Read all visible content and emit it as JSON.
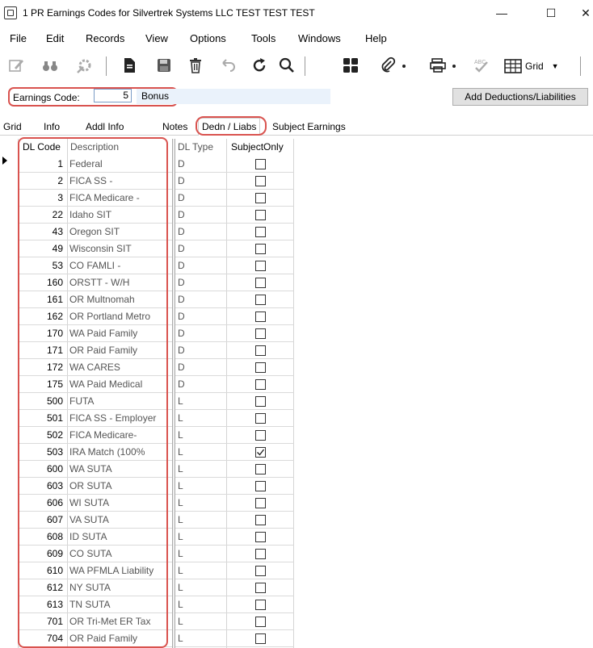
{
  "window": {
    "title": "1 PR Earnings Codes for Silvertrek Systems LLC TEST TEST TEST",
    "minimize": "—",
    "maximize": "☐",
    "close": "✕"
  },
  "menu": [
    "File",
    "Edit",
    "Records",
    "View",
    "Options",
    "Tools",
    "Windows",
    "Help"
  ],
  "toolbar": {
    "grid_label": "Grid",
    "icons": [
      "edit-icon",
      "binoculars-icon",
      "settings-wand-icon",
      "document-icon",
      "save-icon",
      "delete-icon",
      "undo-icon",
      "refresh-icon",
      "search-icon",
      "calculator-icon",
      "attach-icon",
      "print-icon",
      "spellcheck-icon",
      "grid-view-icon"
    ]
  },
  "form": {
    "earnings_code_label": "Earnings Code:",
    "earnings_code_value": "5",
    "earnings_code_desc": "Bonus",
    "add_button": "Add Deductions/Liabilities"
  },
  "tabs": [
    "Grid",
    "Info",
    "Addl Info",
    "Notes",
    "Dedn / Liabs",
    "Subject Earnings"
  ],
  "selected_tab": "Dedn / Liabs",
  "grid": {
    "headers": {
      "code": "DL Code",
      "description": "Description",
      "type": "DL Type",
      "subject": "SubjectOnly"
    },
    "rows": [
      {
        "code": "1",
        "description": "Federal",
        "type": "D",
        "subject": false
      },
      {
        "code": "2",
        "description": "FICA SS -",
        "type": "D",
        "subject": false
      },
      {
        "code": "3",
        "description": "FICA Medicare -",
        "type": "D",
        "subject": false
      },
      {
        "code": "22",
        "description": "Idaho SIT",
        "type": "D",
        "subject": false
      },
      {
        "code": "43",
        "description": "Oregon SIT",
        "type": "D",
        "subject": false
      },
      {
        "code": "49",
        "description": "Wisconsin SIT",
        "type": "D",
        "subject": false
      },
      {
        "code": "53",
        "description": "CO FAMLI -",
        "type": "D",
        "subject": false
      },
      {
        "code": "160",
        "description": "ORSTT - W/H",
        "type": "D",
        "subject": false
      },
      {
        "code": "161",
        "description": "OR Multnomah",
        "type": "D",
        "subject": false
      },
      {
        "code": "162",
        "description": "OR Portland Metro",
        "type": "D",
        "subject": false
      },
      {
        "code": "170",
        "description": "WA Paid Family",
        "type": "D",
        "subject": false
      },
      {
        "code": "171",
        "description": "OR Paid Family",
        "type": "D",
        "subject": false
      },
      {
        "code": "172",
        "description": "WA CARES",
        "type": "D",
        "subject": false
      },
      {
        "code": "175",
        "description": "WA Paid Medical",
        "type": "D",
        "subject": false
      },
      {
        "code": "500",
        "description": "FUTA",
        "type": "L",
        "subject": false
      },
      {
        "code": "501",
        "description": "FICA SS - Employer",
        "type": "L",
        "subject": false
      },
      {
        "code": "502",
        "description": "FICA Medicare-",
        "type": "L",
        "subject": false
      },
      {
        "code": "503",
        "description": "IRA Match (100%",
        "type": "L",
        "subject": true
      },
      {
        "code": "600",
        "description": "WA SUTA",
        "type": "L",
        "subject": false
      },
      {
        "code": "603",
        "description": "OR SUTA",
        "type": "L",
        "subject": false
      },
      {
        "code": "606",
        "description": "WI SUTA",
        "type": "L",
        "subject": false
      },
      {
        "code": "607",
        "description": "VA SUTA",
        "type": "L",
        "subject": false
      },
      {
        "code": "608",
        "description": "ID SUTA",
        "type": "L",
        "subject": false
      },
      {
        "code": "609",
        "description": "CO SUTA",
        "type": "L",
        "subject": false
      },
      {
        "code": "610",
        "description": "WA PFMLA Liability",
        "type": "L",
        "subject": false
      },
      {
        "code": "612",
        "description": "NY SUTA",
        "type": "L",
        "subject": false
      },
      {
        "code": "613",
        "description": "TN SUTA",
        "type": "L",
        "subject": false
      },
      {
        "code": "701",
        "description": "OR Tri-Met ER Tax",
        "type": "L",
        "subject": false
      },
      {
        "code": "704",
        "description": "OR Paid Family",
        "type": "L",
        "subject": false
      }
    ]
  },
  "colors": {
    "highlight": "#d9534f",
    "desc_bg": "#eaf2fb"
  }
}
